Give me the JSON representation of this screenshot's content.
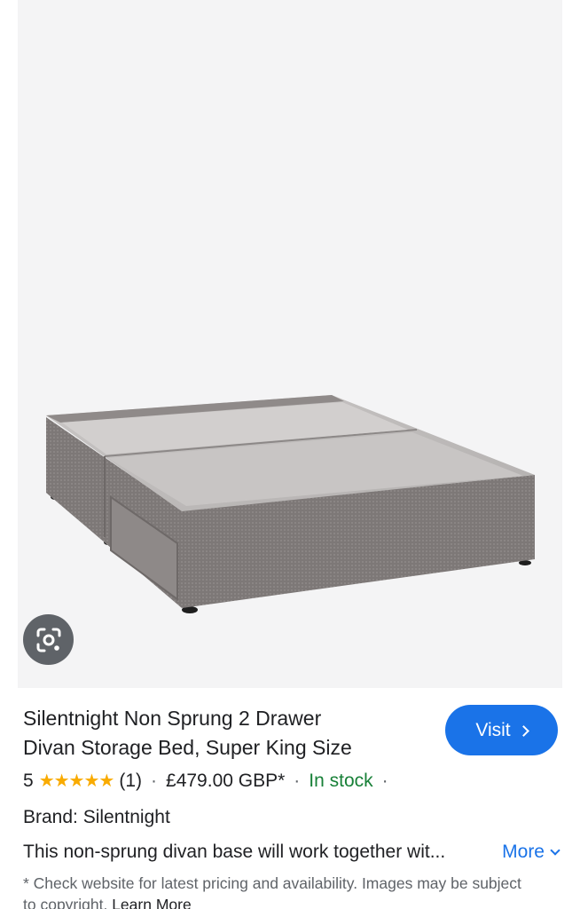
{
  "product": {
    "title_line1": "Silentnight Non Sprung 2 Drawer",
    "title_line2": "Divan Storage Bed, Super King Size",
    "rating": "5",
    "stars": "★★★★★",
    "review_count": "(1)",
    "price": "£479.00 GBP*",
    "availability": "In stock",
    "separator": "·",
    "brand": "Brand: Silentnight",
    "description": "This non-sprung divan base will work together wit...",
    "more_label": "More",
    "disclaimer": "* Check website for latest pricing and availability. Images may be subject to copyright.",
    "learn_more": "Learn More"
  },
  "actions": {
    "visit_label": "Visit"
  },
  "icons": {
    "lens": "google-lens-icon",
    "visit_chevron": "chevron-right-icon",
    "more_chevron": "chevron-down-icon",
    "star": "star-icon"
  },
  "colors": {
    "accent": "#1a73e8",
    "stock": "#188038",
    "star": "#f9ab00",
    "lens_bg": "#5f6368",
    "panel_bg": "#f4f4f5"
  }
}
